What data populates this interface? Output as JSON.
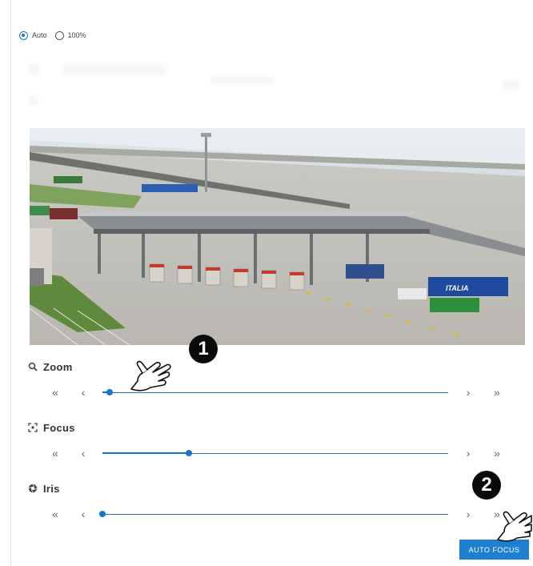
{
  "scale": {
    "options": [
      {
        "label": "Auto",
        "checked": true
      },
      {
        "label": "100%",
        "checked": false
      }
    ]
  },
  "controls": {
    "zoom": {
      "title": "Zoom",
      "icon": "magnifier-icon",
      "level": 0.02
    },
    "focus": {
      "title": "Focus",
      "icon": "focus-frame-icon",
      "level": 0.25
    },
    "iris": {
      "title": "Iris",
      "icon": "aperture-icon",
      "level": 0.0
    },
    "arrows": {
      "far_left": "«",
      "left": "‹",
      "right": "›",
      "far_right": "»"
    }
  },
  "auto_focus": {
    "label": "AUTO FOCUS"
  },
  "steps": [
    "1",
    "2"
  ],
  "camera": {
    "truck_text": "ITALIA"
  },
  "colors": {
    "accent": "#1a73c9",
    "button": "#1e7fd0",
    "badge": "#0a0a0a"
  }
}
